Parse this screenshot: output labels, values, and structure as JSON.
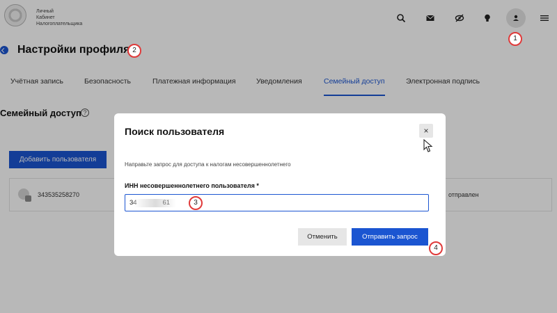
{
  "app": {
    "logo_text_lines": [
      "Личный",
      "Кабинет",
      "Налогоплательщика"
    ]
  },
  "header": {
    "icons": [
      "search-icon",
      "mail-icon",
      "eye-off-icon",
      "lightbulb-icon",
      "profile-icon",
      "menu-icon"
    ]
  },
  "page": {
    "title": "Настройки профиля"
  },
  "tabs": [
    {
      "label": "Учётная запись"
    },
    {
      "label": "Безопасность"
    },
    {
      "label": "Платежная информация"
    },
    {
      "label": "Уведомления"
    },
    {
      "label": "Семейный доступ",
      "active": true
    },
    {
      "label": "Электронная подпись"
    }
  ],
  "section": {
    "title": "Семейный доступ",
    "help": "?",
    "add_user_label": "Добавить пользователя",
    "user": {
      "inn": "343535258270",
      "status": "отправлен"
    }
  },
  "modal": {
    "title": "Поиск пользователя",
    "close": "×",
    "description": "Направьте запрос для доступа к налогам несовершеннолетнего",
    "field_label": "ИНН несовершеннолетнего пользователя *",
    "inn_value": "34              61",
    "cancel_label": "Отменить",
    "submit_label": "Отправить запрос"
  },
  "markers": [
    "1",
    "2",
    "3",
    "4"
  ],
  "colors": {
    "accent": "#1b55d1",
    "marker": "#e03a3a"
  }
}
